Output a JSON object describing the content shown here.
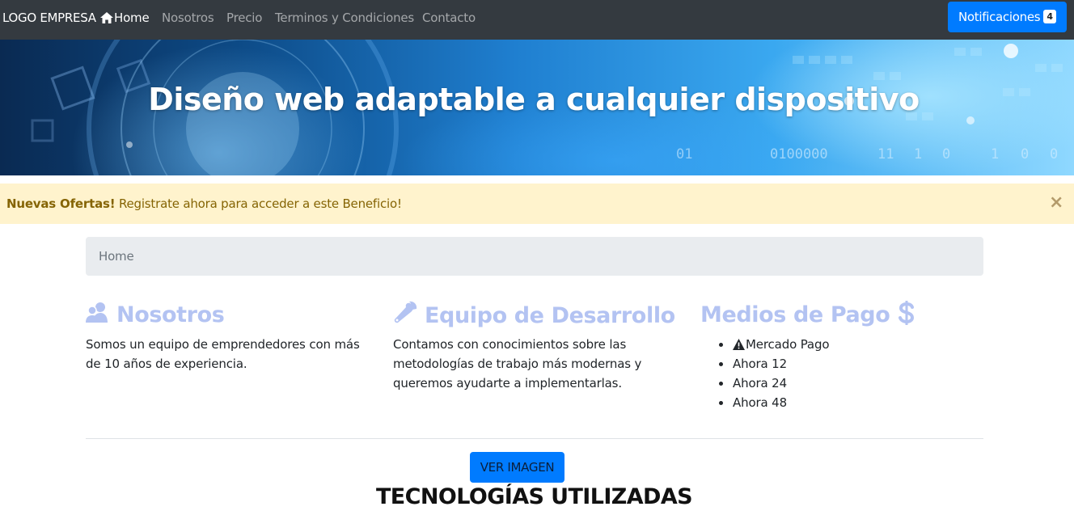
{
  "navbar": {
    "brand": "LOGO EMPRESA",
    "links": [
      {
        "label": "Home",
        "icon": "home-icon",
        "active": true
      },
      {
        "label": "Nosotros"
      },
      {
        "label": "Precio"
      },
      {
        "label": "Terminos y Condiciones"
      },
      {
        "label": "Contacto"
      }
    ],
    "notifications": {
      "label": "Notificaciones",
      "count": "4"
    }
  },
  "hero": {
    "title": "Diseño web adaptable a cualquier dispositivo",
    "background_digits": [
      "01",
      "0100000",
      "11",
      "1",
      "0",
      "1",
      "0",
      "0"
    ]
  },
  "alert": {
    "strong": "Nuevas Ofertas!",
    "text": " Registrate ahora para acceder a este Beneficio!",
    "close": "×"
  },
  "breadcrumb": {
    "current": "Home"
  },
  "columns": {
    "nosotros": {
      "icon": "users-icon",
      "title": "Nosotros",
      "text": "Somos un equipo de emprendedores con más de 10 años de experiencia."
    },
    "equipo": {
      "icon": "wrench-icon",
      "title": "Equipo de Desarrollo",
      "text": "Contamos con conocimientos sobre las metodologías de trabajo más modernas y queremos ayudarte a implementarlas."
    },
    "pagos": {
      "icon": "dollar-icon",
      "title": "Medios de Pago",
      "items": [
        {
          "label": "Mercado Pago",
          "icon": "warning-icon"
        },
        {
          "label": "Ahora 12"
        },
        {
          "label": "Ahora 24"
        },
        {
          "label": "Ahora 48"
        }
      ]
    }
  },
  "actions": {
    "ver_imagen": "VER IMAGEN"
  },
  "section": {
    "title": "TECNOLOGÍAS UTILIZADAS"
  },
  "colors": {
    "navbar": "#343a40",
    "primary": "#007bff",
    "alert_bg": "#fff3cd",
    "alert_text": "#856404",
    "heading_muted": "#b3c3f2",
    "breadcrumb_bg": "#e9ecef"
  }
}
